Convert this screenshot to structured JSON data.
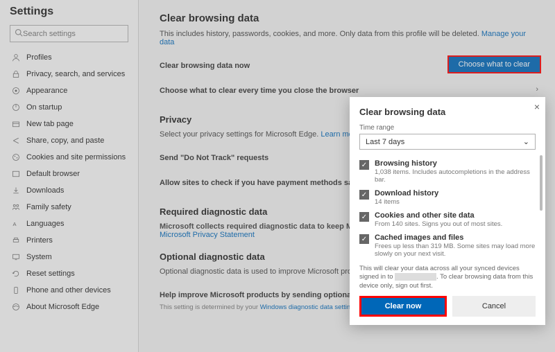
{
  "sidebar": {
    "title": "Settings",
    "search_placeholder": "Search settings",
    "items": [
      {
        "label": "Profiles"
      },
      {
        "label": "Privacy, search, and services"
      },
      {
        "label": "Appearance"
      },
      {
        "label": "On startup"
      },
      {
        "label": "New tab page"
      },
      {
        "label": "Share, copy, and paste"
      },
      {
        "label": "Cookies and site permissions"
      },
      {
        "label": "Default browser"
      },
      {
        "label": "Downloads"
      },
      {
        "label": "Family safety"
      },
      {
        "label": "Languages"
      },
      {
        "label": "Printers"
      },
      {
        "label": "System"
      },
      {
        "label": "Reset settings"
      },
      {
        "label": "Phone and other devices"
      },
      {
        "label": "About Microsoft Edge"
      }
    ]
  },
  "main": {
    "section1_title": "Clear browsing data",
    "section1_desc": "This includes history, passwords, cookies, and more. Only data from this profile will be deleted. ",
    "manage_link": "Manage your data",
    "clear_now_label": "Clear browsing data now",
    "choose_button": "Choose what to clear",
    "close_browser_label": "Choose what to clear every time you close the browser",
    "privacy_title": "Privacy",
    "privacy_desc": "Select your privacy settings for Microsoft Edge. ",
    "learn_more": "Learn more a",
    "dnt_label": "Send \"Do Not Track\" requests",
    "payment_label": "Allow sites to check if you have payment methods saved",
    "diag_title": "Required diagnostic data",
    "diag_desc_prefix": "Microsoft collects required diagnostic data to keep Micros",
    "diag_link": "Microsoft Privacy Statement",
    "optdiag_title": "Optional diagnostic data",
    "optdiag_desc": "Optional diagnostic data is used to improve Microsoft prod",
    "help_label": "Help improve Microsoft products by sending optional diag and crash reports.",
    "help_sub": "This setting is determined by your ",
    "help_sub_link": "Windows diagnostic data setting"
  },
  "dialog": {
    "title": "Clear browsing data",
    "range_label": "Time range",
    "range_value": "Last 7 days",
    "items": [
      {
        "title": "Browsing history",
        "desc": "1,038 items. Includes autocompletions in the address bar."
      },
      {
        "title": "Download history",
        "desc": "14 items"
      },
      {
        "title": "Cookies and other site data",
        "desc": "From 140 sites. Signs you out of most sites."
      },
      {
        "title": "Cached images and files",
        "desc": "Frees up less than 319 MB. Some sites may load more slowly on your next visit."
      }
    ],
    "sync_note_prefix": "This will clear your data across all your synced devices signed in to ",
    "sync_note_suffix": ". To clear browsing data from this device only, ",
    "sign_out_link": "sign out first",
    "clear_btn": "Clear now",
    "cancel_btn": "Cancel"
  }
}
